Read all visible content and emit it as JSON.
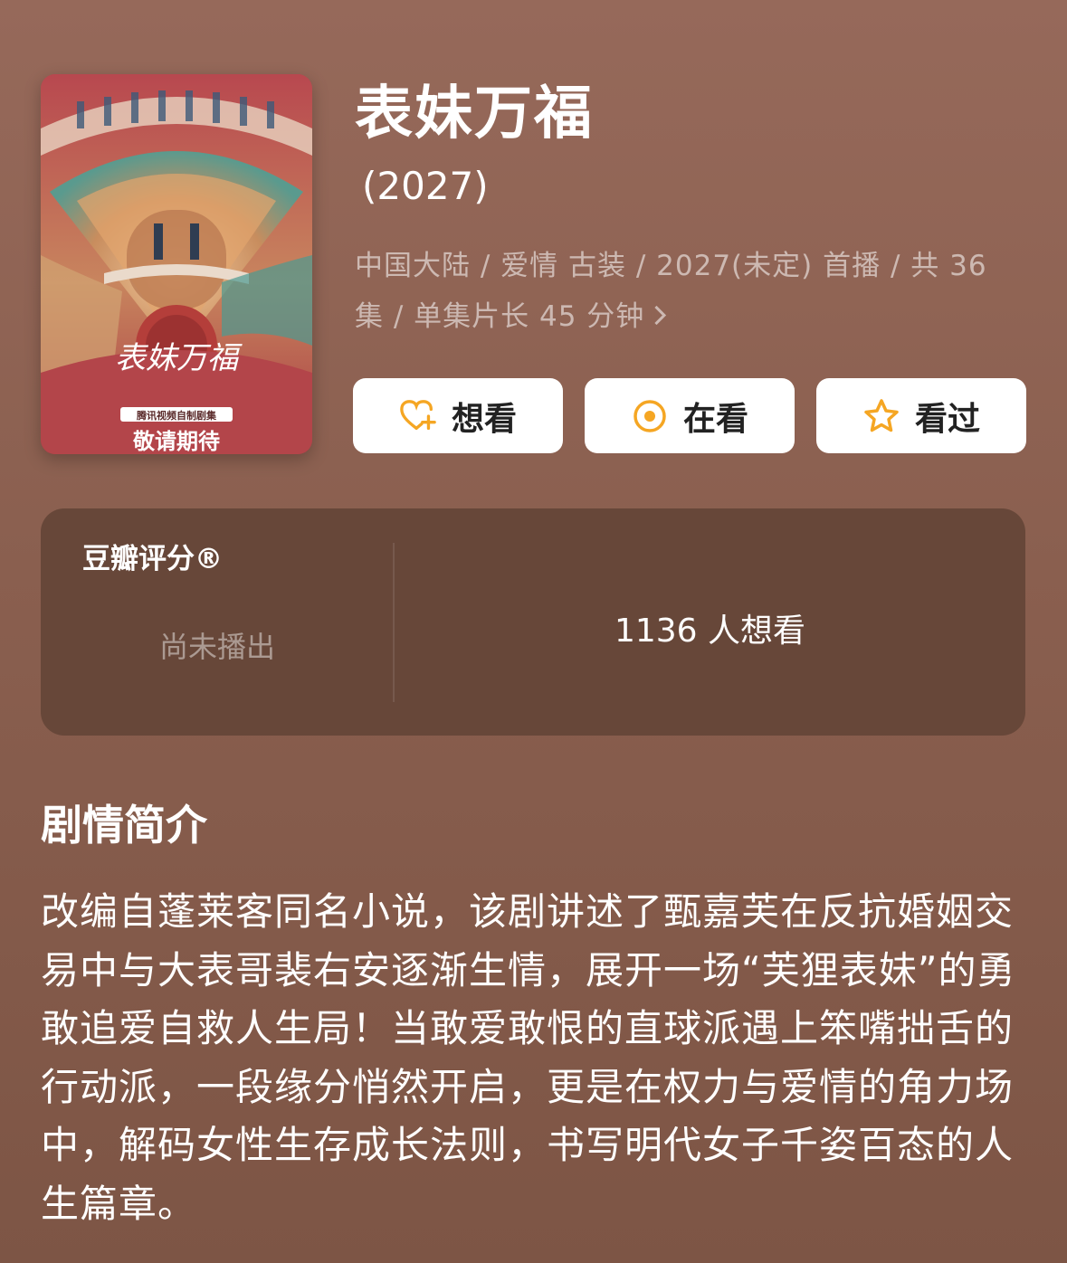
{
  "poster": {
    "title_text": "表妹万福",
    "subtitle_text": "腾讯视频自制剧集",
    "tagline_text": "敬请期待"
  },
  "header": {
    "title": "表妹万福",
    "year": "(2027)",
    "meta": "中国大陆 / 爱情 古装 / 2027(未定) 首播 / 共 36 集 / 单集片长 45 分钟"
  },
  "actions": {
    "want": "想看",
    "watching": "在看",
    "watched": "看过"
  },
  "rating": {
    "label": "豆瓣评分®",
    "status": "尚未播出",
    "wish_count": "1136 人想看"
  },
  "synopsis": {
    "title": "剧情简介",
    "text": "改编自蓬莱客同名小说，该剧讲述了甄嘉芙在反抗婚姻交易中与大表哥裴右安逐渐生情，展开一场“芙狸表妹”的勇敢追爱自救人生局！当敢爱敢恨的直球派遇上笨嘴拙舌的行动派，一段缘分悄然开启，更是在权力与爱情的角力场中，解码女性生存成长法则，书写明代女子千姿百态的人生篇章。"
  },
  "colors": {
    "accent": "#f5a623",
    "card_bg": "#674739"
  }
}
